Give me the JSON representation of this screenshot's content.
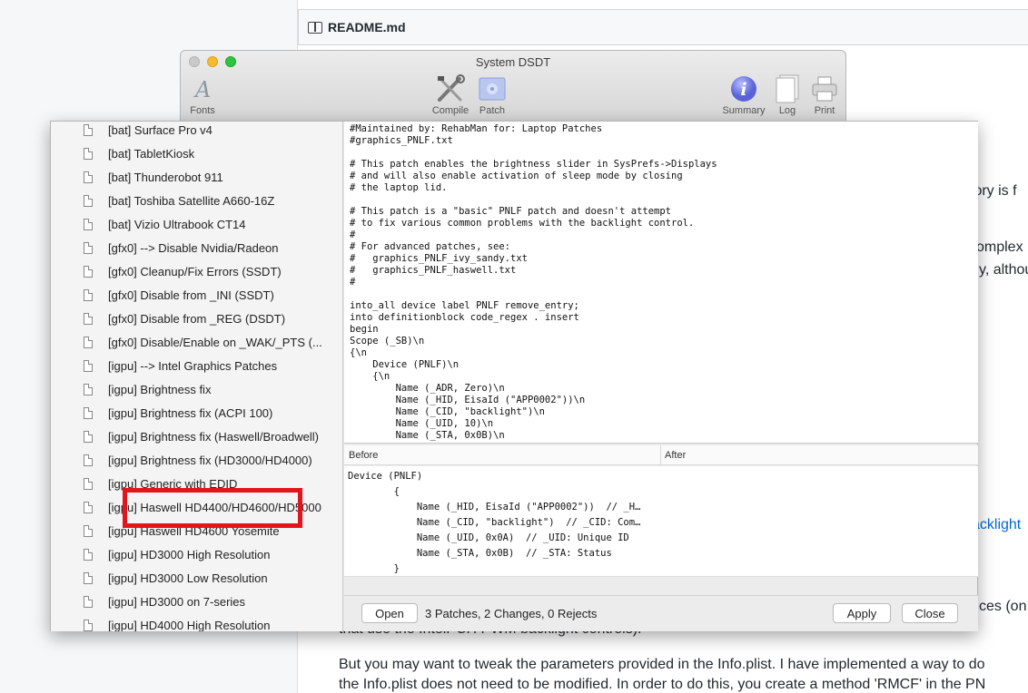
{
  "background": {
    "readme_title": "README.md",
    "fragments": [
      "tory is f",
      "omplex",
      "y, althou",
      "acklight",
      "ces (on",
      "that use the IntelPCH PWM backlight controls).",
      "But you may want to tweak the parameters provided in the Info.plist. I have implemented a way to do",
      "the Info.plist does not need to be modified. In order to do this, you create a method 'RMCF' in the PN"
    ]
  },
  "window": {
    "title": "System DSDT",
    "toolbar": {
      "fonts": "Fonts",
      "compile": "Compile",
      "patch": "Patch",
      "summary": "Summary",
      "log": "Log",
      "print": "Print"
    }
  },
  "patch_list": [
    "[bat] Surface Pro v4",
    "[bat] TabletKiosk",
    "[bat] Thunderobot 911",
    "[bat] Toshiba Satellite A660-16Z",
    "[bat] Vizio Ultrabook CT14",
    "[gfx0] --> Disable Nvidia/Radeon",
    "[gfx0] Cleanup/Fix Errors (SSDT)",
    "[gfx0] Disable from _INI (SSDT)",
    "[gfx0] Disable from _REG (DSDT)",
    "[gfx0] Disable/Enable on _WAK/_PTS (...",
    "[igpu] --> Intel Graphics Patches",
    "[igpu] Brightness fix",
    "[igpu] Brightness fix (ACPI 100)",
    "[igpu] Brightness fix (Haswell/Broadwell)",
    "[igpu] Brightness fix (HD3000/HD4000)",
    "[igpu] Generic with EDID",
    "[igpu] Haswell HD4400/HD4600/HD5000",
    "[igpu] Haswell HD4600 Yosemite",
    "[igpu] HD3000 High Resolution",
    "[igpu] HD3000 Low Resolution",
    "[igpu] HD3000 on 7-series",
    "[igpu] HD4000 High Resolution"
  ],
  "selected_patch": "[igpu] Brightness fix",
  "highlight_color": "#e3151a",
  "code_text": "#Maintained by: RehabMan for: Laptop Patches\n#graphics_PNLF.txt\n\n# This patch enables the brightness slider in SysPrefs->Displays\n# and will also enable activation of sleep mode by closing\n# the laptop lid.\n\n# This patch is a \"basic\" PNLF patch and doesn't attempt\n# to fix various common problems with the backlight control.\n#\n# For advanced patches, see:\n#   graphics_PNLF_ivy_sandy.txt\n#   graphics_PNLF_haswell.txt\n#\n\ninto_all device label PNLF remove_entry;\ninto definitionblock code_regex . insert\nbegin\nScope (_SB)\\n\n{\\n\n    Device (PNLF)\\n\n    {\\n\n        Name (_ADR, Zero)\\n\n        Name (_HID, EisaId (\"APP0002\"))\\n\n        Name (_CID, \"backlight\")\\n\n        Name (_UID, 10)\\n\n        Name (_STA, 0x0B)\\n\n    }\\n",
  "diff": {
    "before_label": "Before",
    "after_label": "After",
    "before_text": "Device (PNLF)\n        {\n            Name (_HID, EisaId (\"APP0002\"))  // _H…\n            Name (_CID, \"backlight\")  // _CID: Com…\n            Name (_UID, 0x0A)  // _UID: Unique ID\n            Name (_STA, 0x0B)  // _STA: Status\n        }"
  },
  "footer": {
    "open_label": "Open",
    "status": "3 Patches, 2 Changes, 0 Rejects",
    "apply_label": "Apply",
    "close_label": "Close"
  }
}
